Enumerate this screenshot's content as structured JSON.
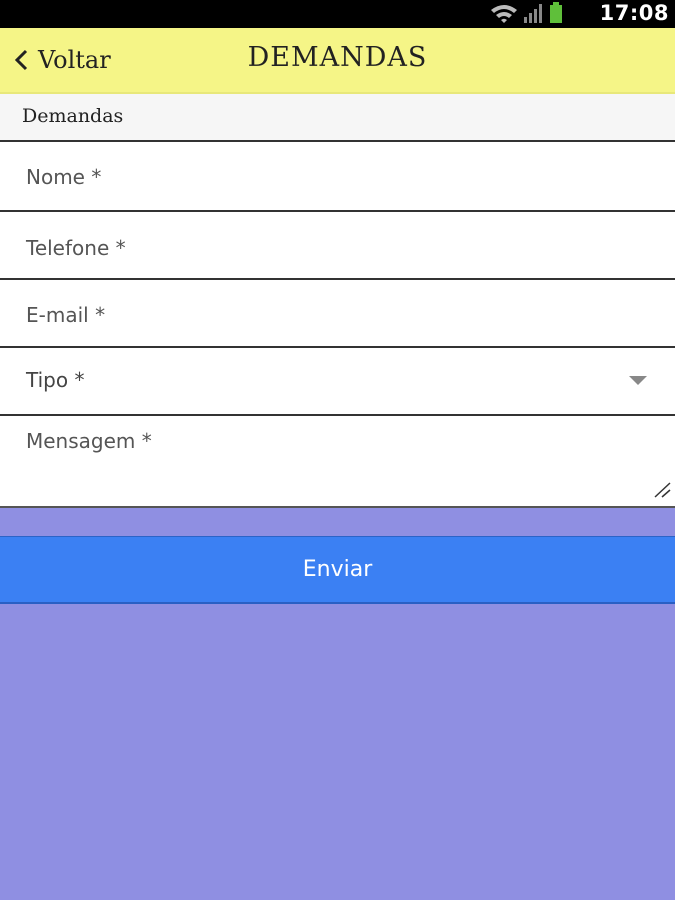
{
  "status_bar": {
    "time": "17:08",
    "icons": [
      "wifi-icon",
      "signal-icon",
      "battery-icon"
    ]
  },
  "header": {
    "back_label": "Voltar",
    "title": "DEMANDAS",
    "background": "#f5f587"
  },
  "section": {
    "label": "Demandas"
  },
  "form": {
    "nome_placeholder": "Nome *",
    "telefone_placeholder": "Telefone *",
    "email_placeholder": "E-mail *",
    "tipo_placeholder": "Tipo *",
    "mensagem_placeholder": "Mensagem *",
    "submit_label": "Enviar"
  },
  "colors": {
    "page_background": "#8f8fe2",
    "submit_button": "#3b80f3"
  }
}
